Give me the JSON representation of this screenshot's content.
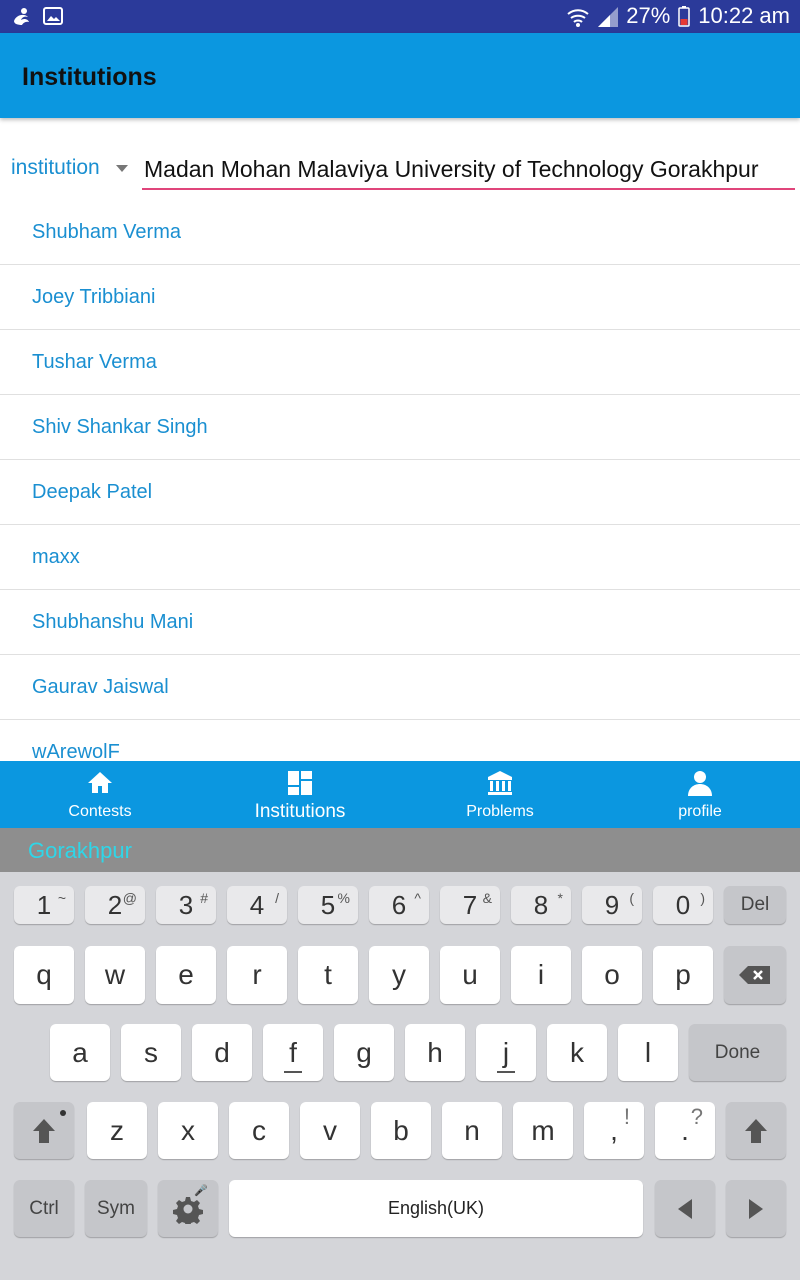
{
  "status_bar": {
    "battery": "27%",
    "time": "10:22 am",
    "icons": [
      "uc-browser-icon",
      "image-icon",
      "wifi-icon",
      "signal-icon",
      "battery-icon"
    ]
  },
  "app_bar": {
    "title": "Institutions"
  },
  "filter": {
    "type_label": "institution",
    "query": "Madan Mohan Malaviya University of Technology Gorakhpur"
  },
  "users": [
    "Shubham Verma",
    "Joey Tribbiani",
    "Tushar Verma",
    "Shiv Shankar Singh",
    "Deepak Patel",
    "maxx",
    "Shubhanshu Mani",
    "Gaurav Jaiswal",
    "wArewolF"
  ],
  "bottom_nav": {
    "items": [
      {
        "label": "Contests",
        "icon": "home-icon"
      },
      {
        "label": "Institutions",
        "icon": "dashboard-icon",
        "active": true
      },
      {
        "label": "Problems",
        "icon": "bank-icon"
      },
      {
        "label": "profile",
        "icon": "person-icon"
      }
    ]
  },
  "keyboard": {
    "suggestion": "Gorakhpur",
    "number_row": [
      {
        "main": "1",
        "sup": "~"
      },
      {
        "main": "2",
        "sup": "@"
      },
      {
        "main": "3",
        "sup": "#"
      },
      {
        "main": "4",
        "sup": "/"
      },
      {
        "main": "5",
        "sup": "%"
      },
      {
        "main": "6",
        "sup": "^"
      },
      {
        "main": "7",
        "sup": "&"
      },
      {
        "main": "8",
        "sup": "*"
      },
      {
        "main": "9",
        "sup": "("
      },
      {
        "main": "0",
        "sup": ")"
      }
    ],
    "del_label": "Del",
    "row1": [
      "q",
      "w",
      "e",
      "r",
      "t",
      "y",
      "u",
      "i",
      "o",
      "p"
    ],
    "row2": [
      "a",
      "s",
      "d",
      "f",
      "g",
      "h",
      "j",
      "k",
      "l"
    ],
    "done_label": "Done",
    "row3": [
      "z",
      "x",
      "c",
      "v",
      "b",
      "n",
      "m"
    ],
    "comma_key": {
      "main": ",",
      "sup": "!"
    },
    "period_key": {
      "main": ".",
      "sup": "?"
    },
    "ctrl_label": "Ctrl",
    "sym_label": "Sym",
    "space_label": "English(UK)"
  }
}
